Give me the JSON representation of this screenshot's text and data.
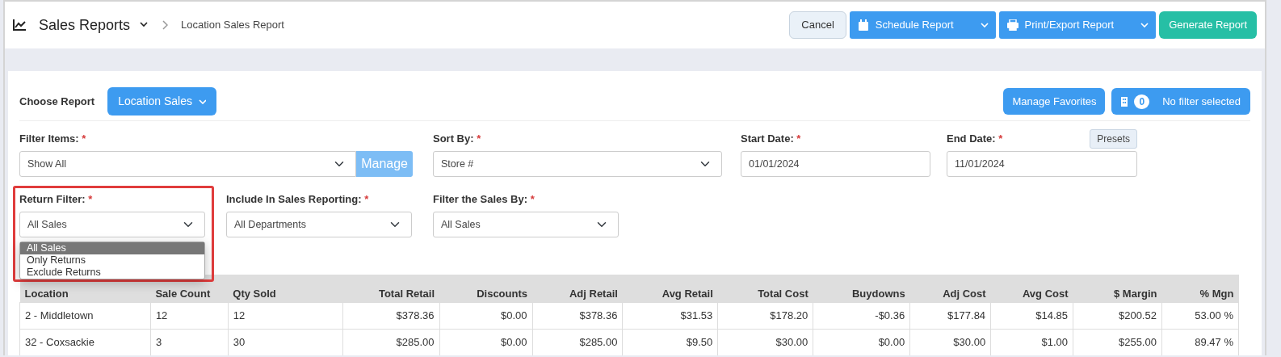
{
  "header": {
    "title": "Sales Reports",
    "breadcrumb": "Location Sales Report",
    "buttons": [
      {
        "kind": "plain",
        "label": "Cancel"
      },
      {
        "kind": "split",
        "label": "Schedule Report"
      },
      {
        "kind": "split",
        "label": "Print/Export Report"
      },
      {
        "kind": "primary",
        "label": "Generate Report"
      }
    ]
  },
  "choose_report": {
    "label": "Choose Report",
    "value": "Location Sales"
  },
  "favorites_button": "Manage Favorites",
  "filter_button": {
    "count": "0",
    "label": "No filter selected"
  },
  "filters_row1": [
    {
      "kind": "select",
      "label": "Filter Items:",
      "mark": "*",
      "value": "Show All",
      "addon": "Manage"
    },
    {
      "kind": "select",
      "label": "Sort By:",
      "mark": "*",
      "value": "Store #"
    },
    {
      "kind": "date",
      "label": "Start Date:",
      "mark": "*",
      "value": "01/01/2024"
    },
    {
      "kind": "date",
      "label": "End Date:",
      "mark": "*",
      "value": "11/01/2024",
      "extra_button": "Presets"
    }
  ],
  "filters_row2": [
    {
      "kind": "select",
      "label": "Return Filter:",
      "mark": "*",
      "value": "All Sales",
      "highlighted": true,
      "open_options": [
        {
          "label": "All Sales",
          "selected": true
        },
        {
          "label": "Only Returns",
          "selected": false
        },
        {
          "label": "Exclude Returns",
          "selected": false
        }
      ]
    },
    {
      "kind": "select",
      "label": "Include In Sales Reporting:",
      "mark": "*",
      "value": "All Departments",
      "highlighted": false
    },
    {
      "kind": "select",
      "label": "Filter the Sales By:",
      "mark": "*",
      "value": "All Sales",
      "highlighted": false
    }
  ],
  "table": {
    "columns": [
      "Location",
      "Sale Count",
      "Qty Sold",
      "Total Retail",
      "Discounts",
      "Adj Retail",
      "Avg Retail",
      "Total Cost",
      "Buydowns",
      "Adj Cost",
      "Avg Cost",
      "$ Margin",
      "% Mgn"
    ],
    "rows": [
      [
        "2 - Middletown",
        "12",
        "12",
        "$378.36",
        "$0.00",
        "$378.36",
        "$31.53",
        "$178.20",
        "-$0.36",
        "$177.84",
        "$14.85",
        "$200.52",
        "53.00 %"
      ],
      [
        "32 - Coxsackie",
        "3",
        "30",
        "$285.00",
        "$0.00",
        "$285.00",
        "$9.50",
        "$30.00",
        "$0.00",
        "$30.00",
        "$1.00",
        "$255.00",
        "89.47 %"
      ]
    ]
  }
}
